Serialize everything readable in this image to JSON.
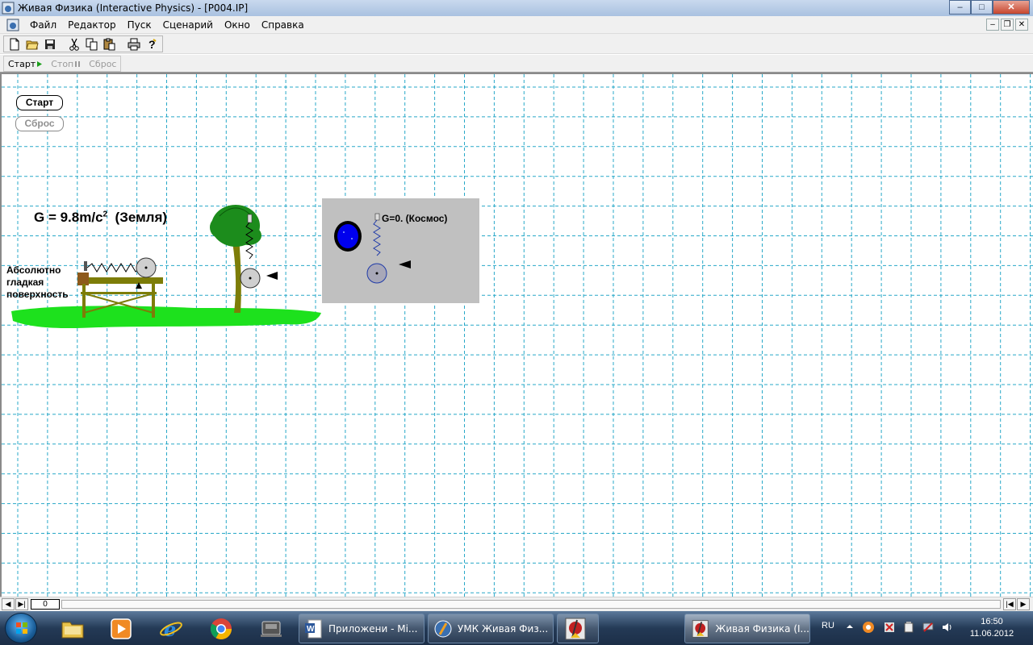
{
  "window": {
    "title": "Живая Физика (Interactive Physics) - [P004.IP]",
    "controls": {
      "minimize": "–",
      "maximize": "□",
      "close": "✕"
    }
  },
  "menu": {
    "items": [
      "Файл",
      "Редактор",
      "Пуск",
      "Сценарий",
      "Окно",
      "Справка"
    ],
    "mdi_controls": {
      "minimize": "–",
      "restore": "❐",
      "close": "✕"
    }
  },
  "toolbar": {
    "buttons": [
      "new-icon",
      "open-icon",
      "save-icon",
      "cut-icon",
      "copy-icon",
      "paste-icon",
      "print-icon",
      "help-icon"
    ]
  },
  "controls": {
    "start": "Старт",
    "stop": "Стоп",
    "reset": "Сброс"
  },
  "workspace": {
    "start_button": "Старт",
    "reset_button": "Сброс",
    "earth_label_prefix": "G = 9.8m/c",
    "earth_label_exp": "2",
    "earth_label_suffix": "(Земля)",
    "surface_label_lines": [
      "Абсолютно",
      "гладкая",
      "поверхность"
    ],
    "space_label": "G=0. (Космос)"
  },
  "scrollbar": {
    "frame_value": "0"
  },
  "taskbar": {
    "pinned": [
      "explorer-icon",
      "media-player-icon",
      "internet-explorer-icon",
      "chrome-icon",
      "device-icon"
    ],
    "tasks": [
      {
        "label": "Приложени - Mi...",
        "icon": "word-icon",
        "active": false
      },
      {
        "label": "УМК Живая Физ...",
        "icon": "physics-app-icon",
        "active": false
      },
      {
        "label": "",
        "icon": "physics-app-icon",
        "active": false
      },
      {
        "label": "Живая Физика (I...",
        "icon": "physics-app-icon",
        "active": true
      }
    ],
    "language": "RU",
    "time": "16:50",
    "date": "11.06.2012"
  }
}
